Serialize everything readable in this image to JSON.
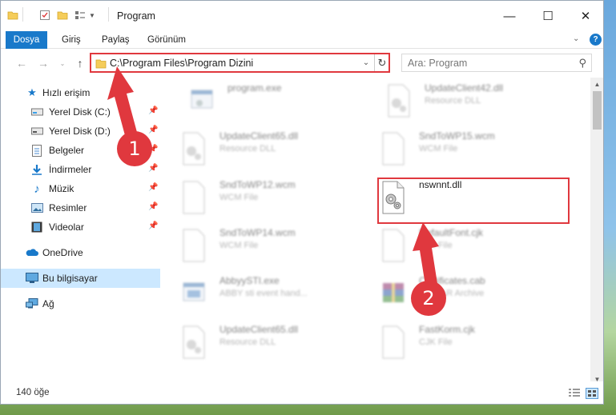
{
  "window": {
    "title": "Program"
  },
  "ribbon": {
    "tabs": [
      "Dosya",
      "Giriş",
      "Paylaş",
      "Görünüm"
    ]
  },
  "address": {
    "path": "C:\\Program Files\\Program Dizini"
  },
  "search": {
    "placeholder": "Ara: Program"
  },
  "sidebar": {
    "items": [
      {
        "label": "Hızlı erişim",
        "icon": "star-icon"
      },
      {
        "label": "Yerel Disk (C:)",
        "icon": "drive-icon"
      },
      {
        "label": "Yerel Disk (D:)",
        "icon": "drive-icon"
      },
      {
        "label": "Belgeler",
        "icon": "documents-icon"
      },
      {
        "label": "İndirmeler",
        "icon": "download-icon"
      },
      {
        "label": "Müzik",
        "icon": "music-icon"
      },
      {
        "label": "Resimler",
        "icon": "pictures-icon"
      },
      {
        "label": "Videolar",
        "icon": "videos-icon"
      },
      {
        "label": "OneDrive",
        "icon": "cloud-icon"
      },
      {
        "label": "Bu bilgisayar",
        "icon": "computer-icon"
      },
      {
        "label": "Ağ",
        "icon": "network-icon"
      }
    ]
  },
  "files": [
    {
      "name": "program.exe",
      "type": ""
    },
    {
      "name": "UpdateClient42.dll",
      "type": "Resource DLL"
    },
    {
      "name": "UpdateClient65.dll",
      "type": "Resource DLL"
    },
    {
      "name": "SndToWP15.wcm",
      "type": "WCM File"
    },
    {
      "name": "SndToWP12.wcm",
      "type": "WCM File"
    },
    {
      "name": "nswnnt.dll",
      "type": ""
    },
    {
      "name": "SndToWP14.wcm",
      "type": "WCM File"
    },
    {
      "name": "DefaultFont.cjk",
      "type": "CJK File"
    },
    {
      "name": "AbbyySTI.exe",
      "type": "ABBY sti event hand..."
    },
    {
      "name": "Certificates.cab",
      "type": "WinRAR Archive"
    },
    {
      "name": "UpdateClient65.dll",
      "type": "Resource DLL"
    },
    {
      "name": "FastKorm.cjk",
      "type": "CJK File"
    }
  ],
  "status": {
    "count": "140 öğe"
  },
  "markers": [
    "1",
    "2"
  ],
  "colors": {
    "accent": "#1979ca",
    "highlight": "#e0383e",
    "selected": "#cce8ff"
  }
}
